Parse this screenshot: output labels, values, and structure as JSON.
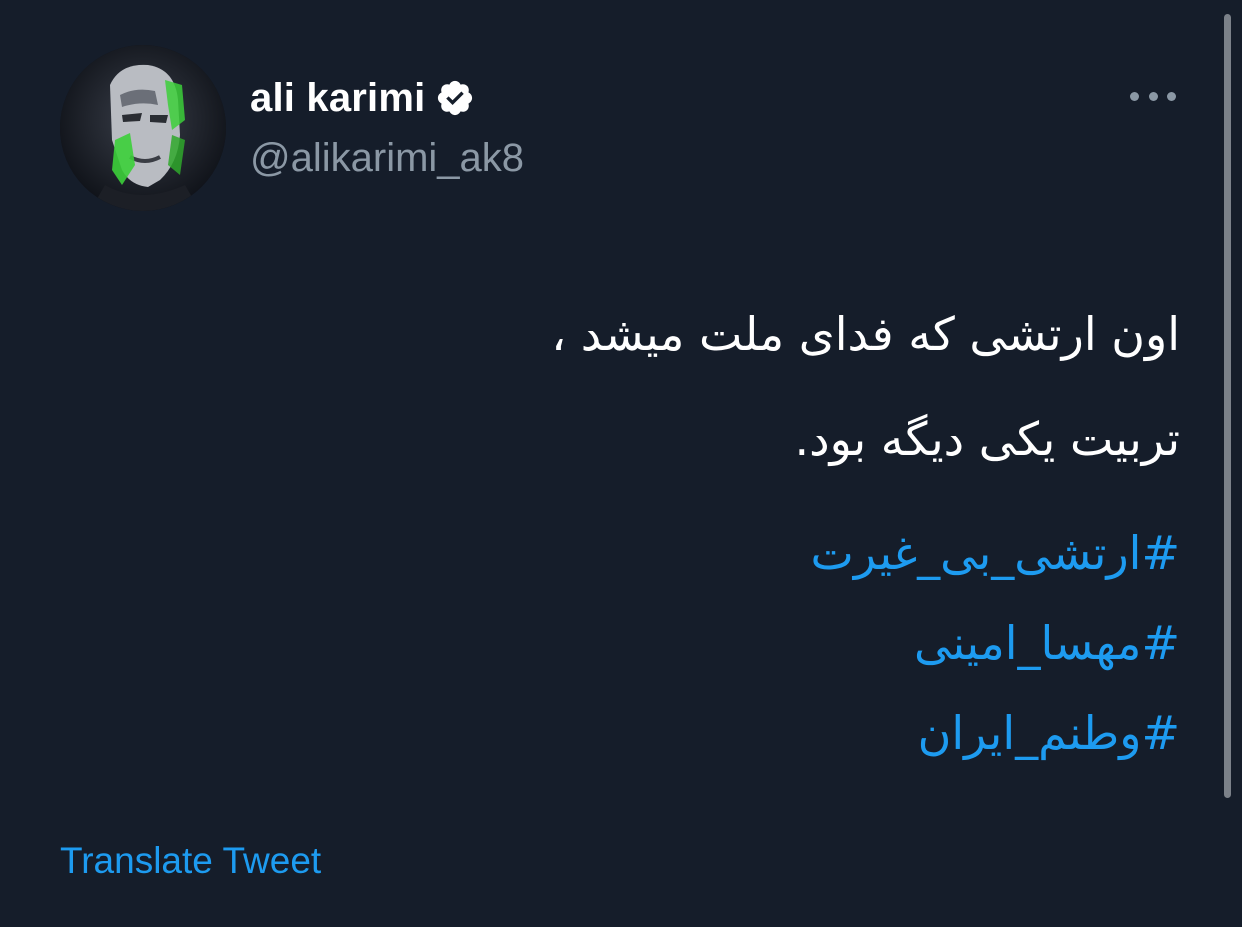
{
  "tweet": {
    "author": {
      "display_name": "ali karimi",
      "handle": "@alikarimi_ak8",
      "verified": true
    },
    "text_lines": [
      "اون ارتشی که فدای ملت میشد ،",
      "تربیت یکی دیگه بود."
    ],
    "hashtags": [
      "#ارتشی_بی_غیرت",
      "#مهسا_امینی",
      "#وطنم_ایران"
    ],
    "translate_label": "Translate Tweet"
  },
  "icons": {
    "more": "more-horizontal-icon",
    "verified": "verified-badge-icon",
    "avatar": "profile-avatar"
  },
  "colors": {
    "background": "#151d2a",
    "primary_text": "#ffffff",
    "secondary_text": "#8b98a5",
    "link": "#1d9bf0",
    "verified_badge": "#ffffff"
  }
}
